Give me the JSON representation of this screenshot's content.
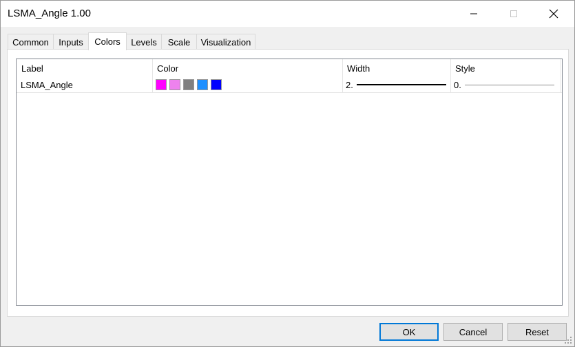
{
  "window": {
    "title": "LSMA_Angle 1.00"
  },
  "tabs": [
    {
      "label": "Common",
      "active": false
    },
    {
      "label": "Inputs",
      "active": false
    },
    {
      "label": "Colors",
      "active": true
    },
    {
      "label": "Levels",
      "active": false
    },
    {
      "label": "Scale",
      "active": false
    },
    {
      "label": "Visualization",
      "active": false
    }
  ],
  "table": {
    "columns": [
      "Label",
      "Color",
      "Width",
      "Style"
    ],
    "rows": [
      {
        "label": "LSMA_Angle",
        "colors": [
          "#ff00ff",
          "#ee82ee",
          "#808080",
          "#1e90ff",
          "#0000ff"
        ],
        "width": "2.",
        "style": "0."
      }
    ]
  },
  "buttons": {
    "ok": "OK",
    "cancel": "Cancel",
    "reset": "Reset"
  },
  "icons": {
    "minimize": "minimize-icon",
    "maximize": "maximize-icon",
    "close": "close-icon",
    "grip": "resize-grip-icon"
  }
}
